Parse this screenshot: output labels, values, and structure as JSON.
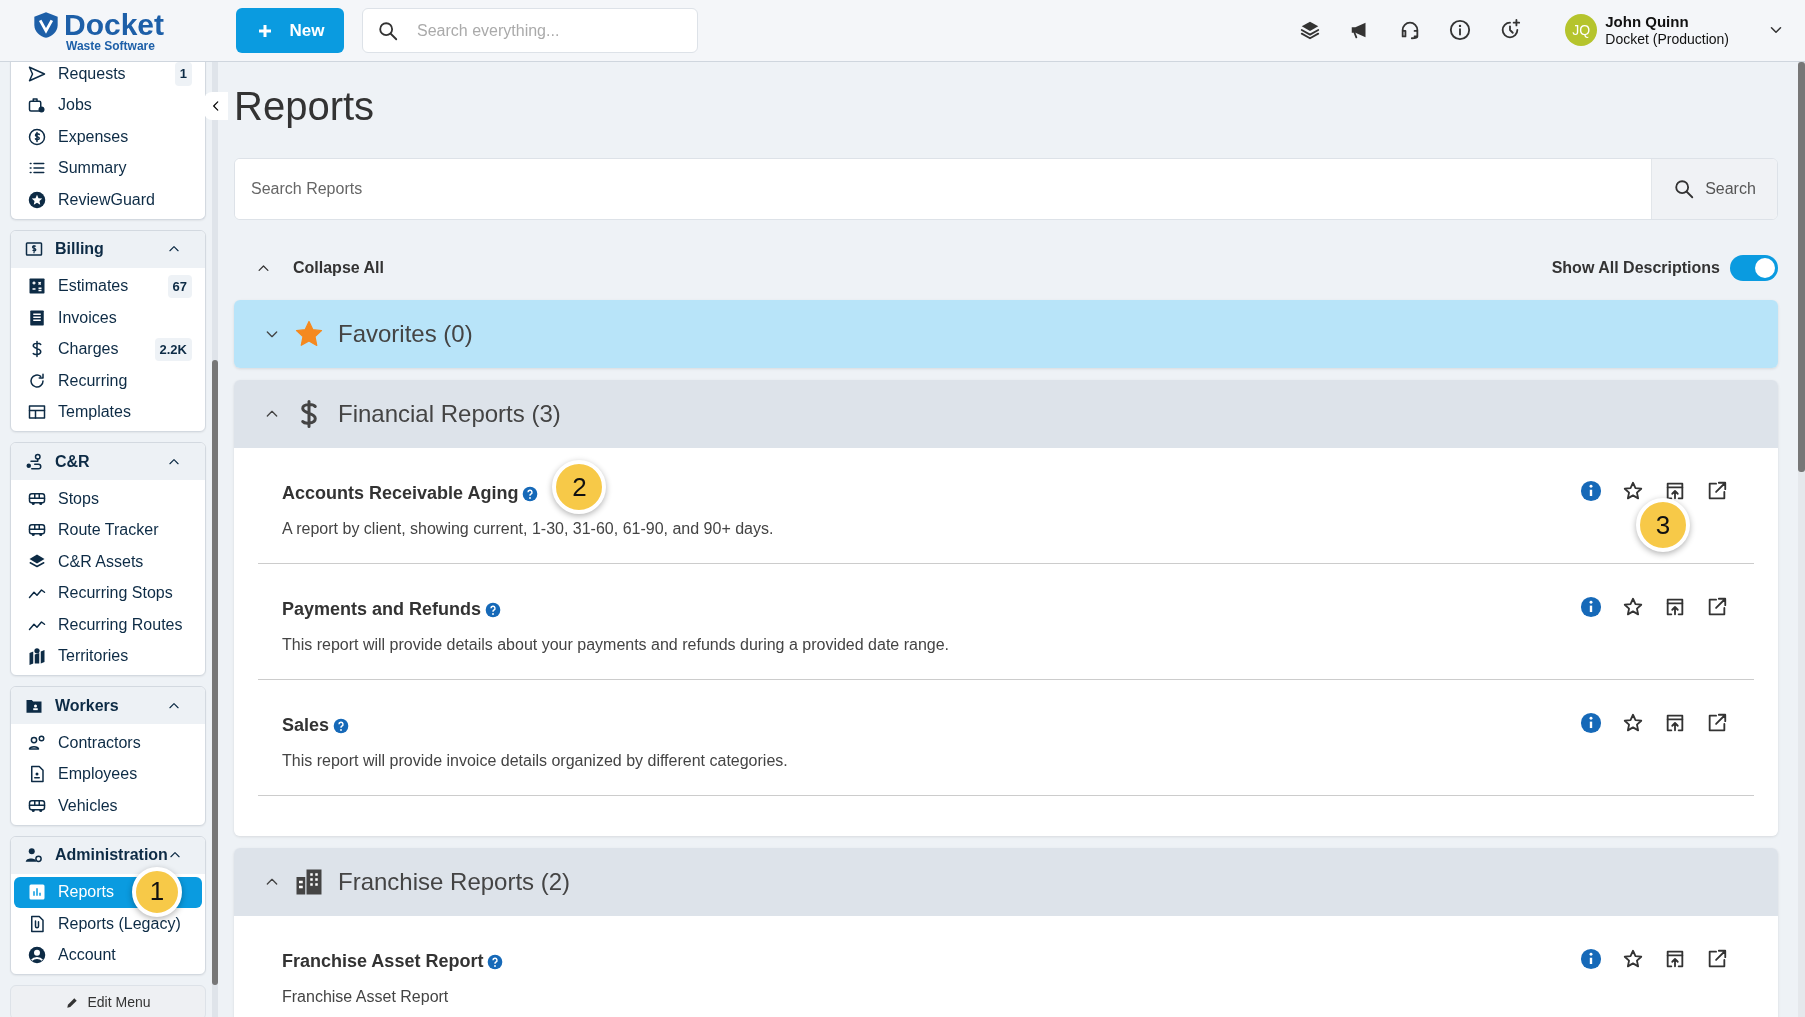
{
  "header": {
    "logo_title": "Docket",
    "logo_subtitle": "Waste Software",
    "new_button": "New",
    "search": {
      "placeholder": "Search everything..."
    },
    "user": {
      "initials": "JQ",
      "name": "John Quinn",
      "org": "Docket (Production)"
    }
  },
  "sidebar": {
    "groups": [
      {
        "items": [
          {
            "label": "Requests",
            "badge": "1",
            "selected": false
          },
          {
            "label": "Jobs",
            "selected": false
          },
          {
            "label": "Expenses",
            "selected": false
          },
          {
            "label": "Summary",
            "selected": false
          },
          {
            "label": "ReviewGuard",
            "selected": false
          }
        ]
      },
      {
        "title": "Billing",
        "expanded": true,
        "items": [
          {
            "label": "Estimates",
            "badge": "67",
            "selected": false
          },
          {
            "label": "Invoices",
            "selected": false
          },
          {
            "label": "Charges",
            "badge": "2.2K",
            "selected": false
          },
          {
            "label": "Recurring",
            "selected": false
          },
          {
            "label": "Templates",
            "selected": false
          }
        ]
      },
      {
        "title": "C&R",
        "expanded": true,
        "items": [
          {
            "label": "Stops",
            "selected": false
          },
          {
            "label": "Route Tracker",
            "selected": false
          },
          {
            "label": "C&R Assets",
            "selected": false
          },
          {
            "label": "Recurring Stops",
            "selected": false
          },
          {
            "label": "Recurring Routes",
            "selected": false
          },
          {
            "label": "Territories",
            "selected": false
          }
        ]
      },
      {
        "title": "Workers",
        "expanded": true,
        "items": [
          {
            "label": "Contractors",
            "selected": false
          },
          {
            "label": "Employees",
            "selected": false
          },
          {
            "label": "Vehicles",
            "selected": false
          }
        ]
      },
      {
        "title": "Administration",
        "expanded": true,
        "items": [
          {
            "label": "Reports",
            "selected": true,
            "callout": "1"
          },
          {
            "label": "Reports (Legacy)",
            "selected": false
          },
          {
            "label": "Account",
            "selected": false
          }
        ]
      }
    ],
    "edit_menu": "Edit Menu"
  },
  "page": {
    "title": "Reports",
    "search": {
      "placeholder": "Search Reports",
      "button": "Search"
    },
    "collapse_all": "Collapse All",
    "show_descriptions": {
      "label": "Show All Descriptions",
      "on": true
    },
    "sections": [
      {
        "kind": "favorites",
        "title": "Favorites (0)",
        "expanded": false
      },
      {
        "kind": "financial",
        "title": "Financial Reports (3)",
        "expanded": true,
        "reports": [
          {
            "name": "Accounts Receivable Aging",
            "description": "A report by client, showing current, 1-30, 31-60, 61-90, and 90+ days.",
            "name_callout": "2",
            "actions_callout": "3"
          },
          {
            "name": "Payments and Refunds",
            "description": "This report will provide details about your payments and refunds during a provided date range."
          },
          {
            "name": "Sales",
            "description": "This report will provide invoice details organized by different categories."
          }
        ]
      },
      {
        "kind": "franchise",
        "title": "Franchise Reports (2)",
        "expanded": true,
        "reports": [
          {
            "name": "Franchise Asset Report",
            "description": "Franchise Asset Report"
          }
        ]
      }
    ]
  }
}
